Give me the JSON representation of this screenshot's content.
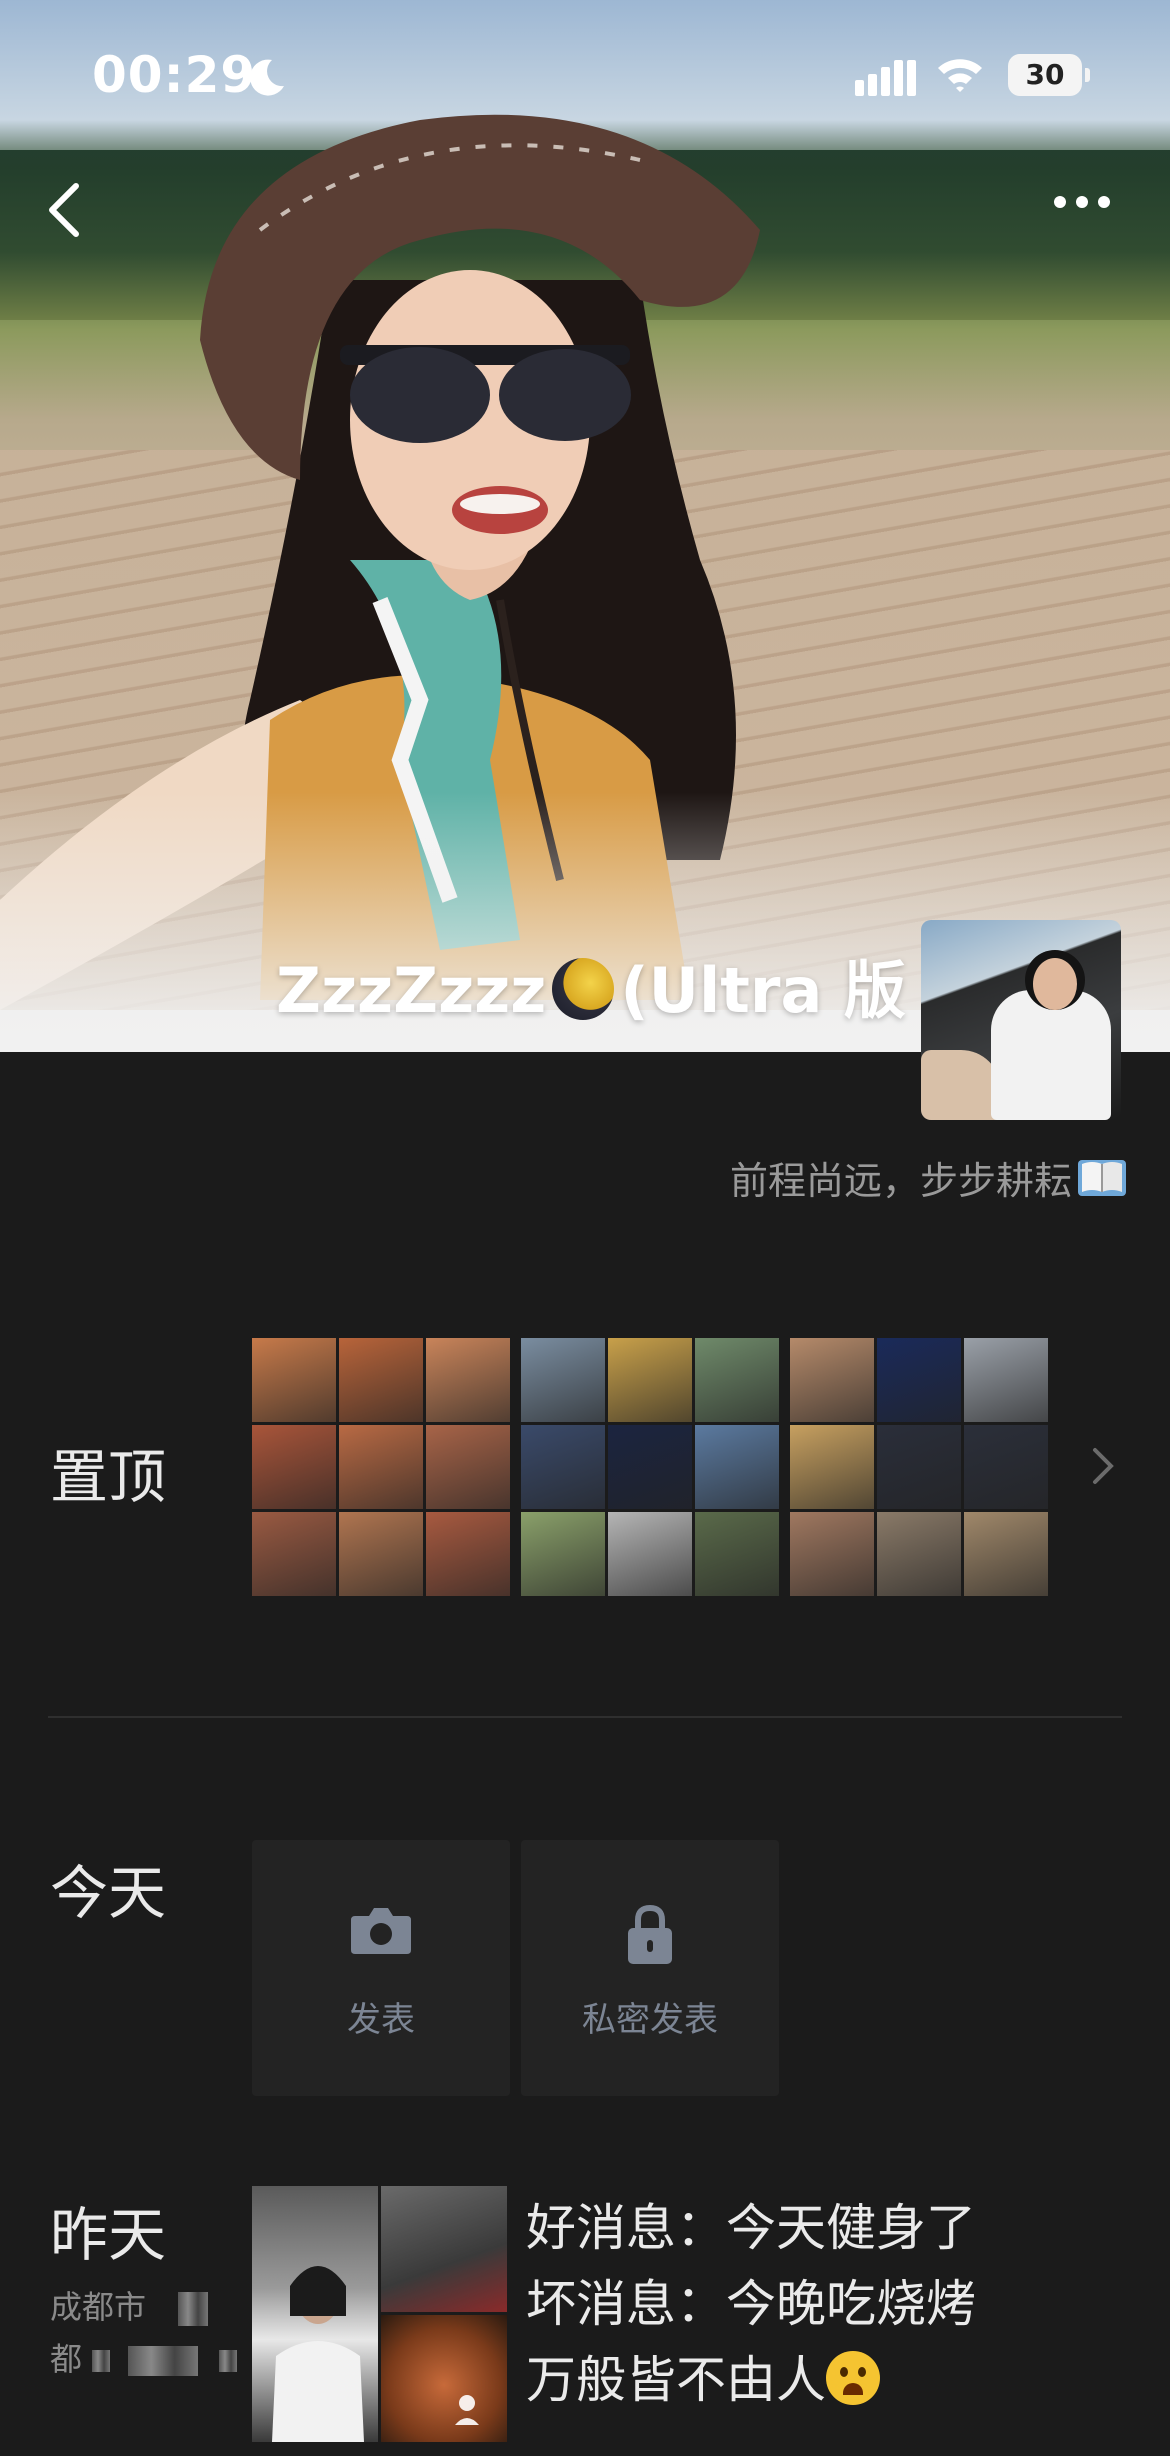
{
  "status_bar": {
    "time": "00:29",
    "battery": "30"
  },
  "profile": {
    "name_prefix": "ZzzZzzz",
    "name_suffix": "(Ultra 版",
    "motto": "前程尚远，步步耕耘"
  },
  "sections": {
    "pinned_label": "置顶",
    "today_label": "今天",
    "yesterday_label": "昨天",
    "location_line1": "成都市",
    "location_line2": "都"
  },
  "actions": {
    "post_label": "发表",
    "private_post_label": "私密发表"
  },
  "icons": {
    "back": "back-chevron-icon",
    "more": "more-dots-icon",
    "camera": "camera-icon",
    "lock": "lock-icon",
    "book": "book-icon",
    "moon": "moon-icon"
  },
  "pinned_albums": [
    {
      "cells": [
        "#c77a4a",
        "#b8643a",
        "#c9845a",
        "#a9553a",
        "#b96a44",
        "#a86448",
        "#9a5a42",
        "#b07550",
        "#a85a40"
      ]
    },
    {
      "cells": [
        "#7a8da0",
        "#c8a04a",
        "#6f8a6a",
        "#3a4a6a",
        "#1b2440",
        "#5b7aa0",
        "#8aa06a",
        "#b5b5b5",
        "#5a6a4a"
      ]
    },
    {
      "cells": [
        "#b58a6a",
        "#1a2a5a",
        "#9aa0a8",
        "#c7a060",
        "#2a2e3a",
        "#2b2f3a",
        "#a07860",
        "#8a7a68",
        "#a0886a"
      ]
    }
  ],
  "yesterday_post": {
    "line1": "好消息：今天健身了",
    "line2": "坏消息：今晚吃烧烤",
    "line3": "万般皆不由人"
  },
  "colors": {
    "background": "#1b1b1b",
    "muted_text": "#9a9a9a",
    "button_text": "#7c8594"
  }
}
